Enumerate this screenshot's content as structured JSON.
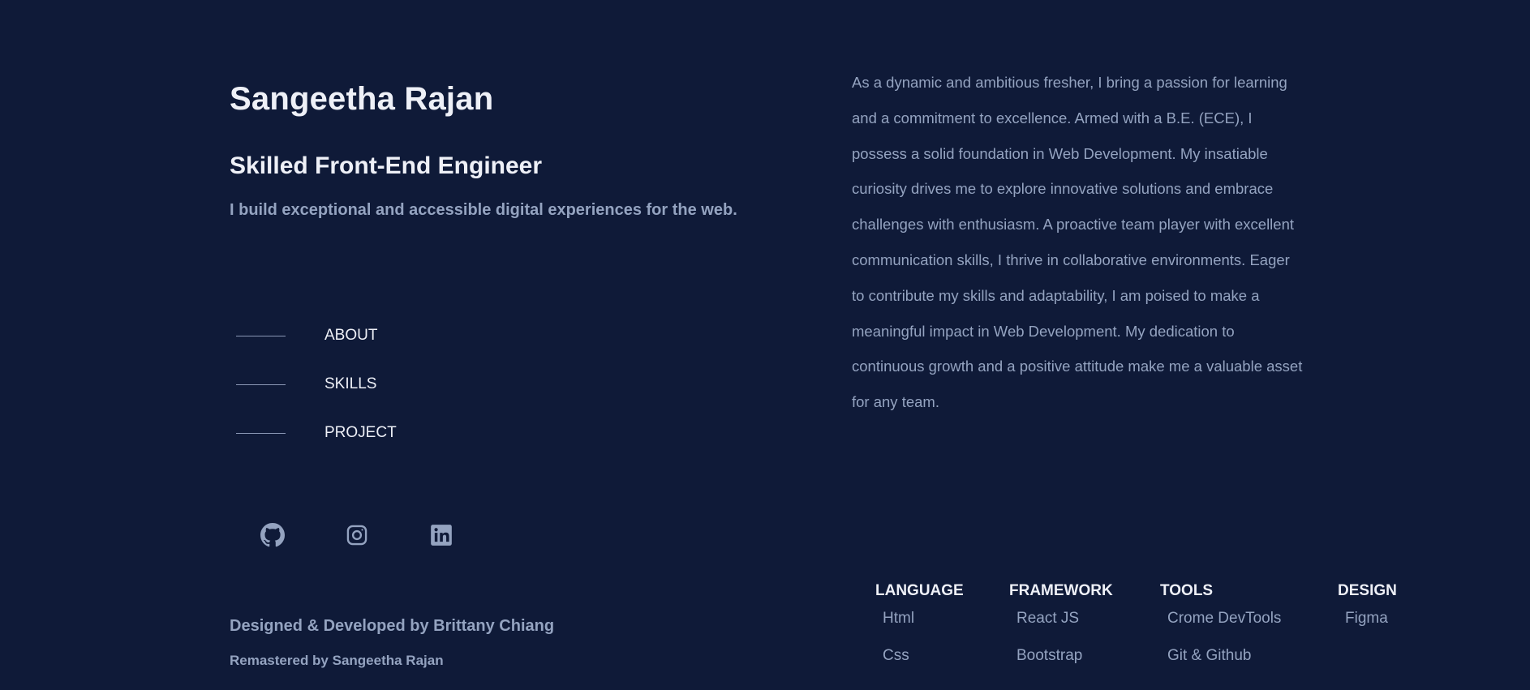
{
  "hero": {
    "name": "Sangeetha Rajan",
    "role": "Skilled Front-End Engineer",
    "tagline": "I build exceptional and accessible digital experiences for the web."
  },
  "nav": {
    "items": [
      {
        "label": "ABOUT"
      },
      {
        "label": "SKILLS"
      },
      {
        "label": "PROJECT"
      }
    ]
  },
  "socials": {
    "items": [
      {
        "icon": "github-icon"
      },
      {
        "icon": "instagram-icon"
      },
      {
        "icon": "linkedin-icon"
      }
    ]
  },
  "footer": {
    "credit": "Designed & Developed by Brittany Chiang",
    "remaster": "Remastered by Sangeetha Rajan"
  },
  "about": {
    "text": "As a dynamic and ambitious fresher, I bring a passion for learning and a commitment to excellence. Armed with a B.E. (ECE), I possess a solid foundation in Web Development. My insatiable curiosity drives me to explore innovative solutions and embrace challenges with enthusiasm. A proactive team player with excellent communication skills, I thrive in collaborative environments. Eager to contribute my skills and adaptability, I am poised to make a meaningful impact in Web Development. My dedication to continuous growth and a positive attitude make me a valuable asset for any team."
  },
  "skills": {
    "columns": [
      {
        "heading": "LANGUAGE",
        "items": [
          "Html",
          "Css"
        ]
      },
      {
        "heading": "FRAMEWORK",
        "items": [
          "React JS",
          "Bootstrap"
        ]
      },
      {
        "heading": "TOOLS",
        "items": [
          "Crome DevTools",
          "Git & Github"
        ]
      },
      {
        "heading": "DESIGN",
        "items": [
          "Figma"
        ]
      }
    ]
  },
  "colors": {
    "background": "#0f1a38",
    "heading": "#eef0f7",
    "muted": "#94a3c0"
  }
}
